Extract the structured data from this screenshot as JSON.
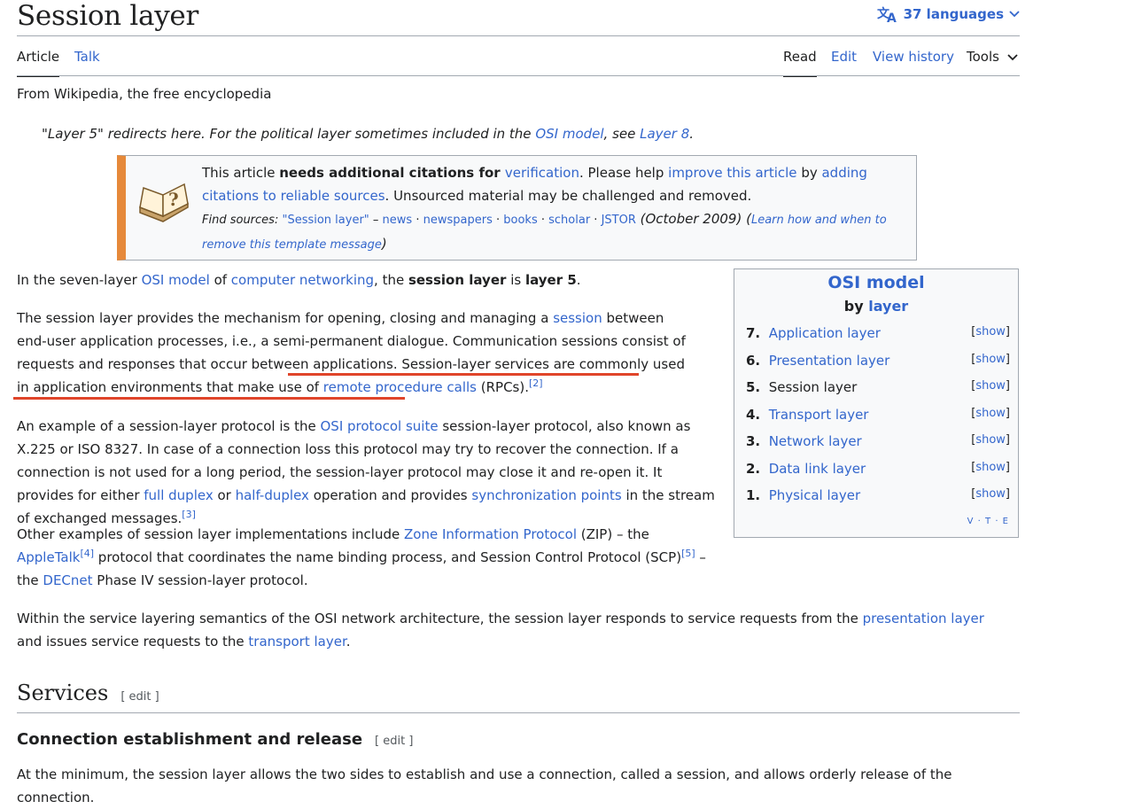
{
  "header": {
    "title": "Session layer",
    "languages": "37 languages"
  },
  "tabs": {
    "article": "Article",
    "talk": "Talk",
    "read": "Read",
    "edit": "Edit",
    "view_history": "View history",
    "tools": "Tools"
  },
  "tagline": "From Wikipedia, the free encyclopedia",
  "hatnote": {
    "t1": "\"Layer 5\" redirects here. For the political layer sometimes included in the ",
    "l1": "OSI model",
    "t2": ", see ",
    "l2": "Layer 8",
    "t3": "."
  },
  "ambox": {
    "t1": "This article ",
    "b1": "needs additional citations for ",
    "l1": "verification",
    "t2": ". Please help ",
    "l2": "improve this article",
    "t3": " by ",
    "l3": "adding citations to reliable sources",
    "t4": ". Unsourced material may be challenged and removed.",
    "find": "Find sources:",
    "q": "\"Session layer\"",
    "dash": " – ",
    "s1": "news",
    "s2": "newspapers",
    "s3": "books",
    "s4": "scholar",
    "s5": "JSTOR",
    "date": " (October 2009) (",
    "learn": "Learn how and when to remove this template message",
    "close": ")"
  },
  "p1": {
    "t1": "In the seven-layer ",
    "l1": "OSI model",
    "t2": " of ",
    "l2": "computer networking",
    "t3": ", the ",
    "b1": "session layer",
    "t4": " is ",
    "b2": "layer 5",
    "t5": "."
  },
  "p2": {
    "t1": "The session layer provides the mechanism for opening, closing and managing a ",
    "l1": "session",
    "t2": " between end-user application processes, i.e., a semi-permanent dialogue. Communication sessions consist of requests and responses that occur between applications. Session-layer services are commonly used in application environments that make use of ",
    "l2": "remote procedure calls",
    "t3": " (RPCs).",
    "ref": "[2]"
  },
  "p3": {
    "t1": "An example of a session-layer protocol is the ",
    "l1": "OSI protocol suite",
    "t2": " session-layer protocol, also known as X.225 or ISO 8327. In case of a connection loss this protocol may try to recover the connection. If a connection is not used for a long period, the session-layer protocol may close it and re-open it. It provides for either ",
    "l2": "full duplex",
    "t3": " or ",
    "l3": "half-duplex",
    "t4": " operation and provides ",
    "l4": "synchronization points",
    "t5": " in the stream of exchanged messages.",
    "ref": "[3]"
  },
  "p4": {
    "t1": "Other examples of session layer implementations include ",
    "l1": "Zone Information Protocol",
    "t2": " (ZIP) – the ",
    "l2": "AppleTalk",
    "ref1": "[4]",
    "t3": " protocol that coordinates the name binding process, and Session Control Protocol (SCP)",
    "ref2": "[5]",
    "t4": " – the ",
    "l3": "DECnet",
    "t5": " Phase IV session-layer protocol."
  },
  "p5": {
    "t1": "Within the service layering semantics of the OSI network architecture, the session layer responds to service requests from the ",
    "l1": "presentation layer",
    "t2": " and issues service requests to the ",
    "l2": "transport layer",
    "t3": "."
  },
  "infobox": {
    "title": "OSI model",
    "by": "by ",
    "by_link": "layer",
    "show": "show",
    "layers": [
      {
        "num": "7.",
        "name": "Application layer",
        "link": true
      },
      {
        "num": "6.",
        "name": "Presentation layer",
        "link": true
      },
      {
        "num": "5.",
        "name": "Session layer",
        "link": false
      },
      {
        "num": "4.",
        "name": "Transport layer",
        "link": true
      },
      {
        "num": "3.",
        "name": "Network layer",
        "link": true
      },
      {
        "num": "2.",
        "name": "Data link layer",
        "link": true
      },
      {
        "num": "1.",
        "name": "Physical layer",
        "link": true
      }
    ],
    "vte": "V · T · E"
  },
  "services": {
    "heading": "Services",
    "edit": "[ edit ]"
  },
  "conn": {
    "heading": "Connection establishment and release",
    "edit": "[ edit ]",
    "text": "At the minimum, the session layer allows the two sides to establish and use a connection, called a session, and allows orderly release of the connection."
  },
  "colors": {
    "link": "#3366cc",
    "ambox_accent": "#e6893a",
    "highlight_underline": "#e0452a"
  }
}
